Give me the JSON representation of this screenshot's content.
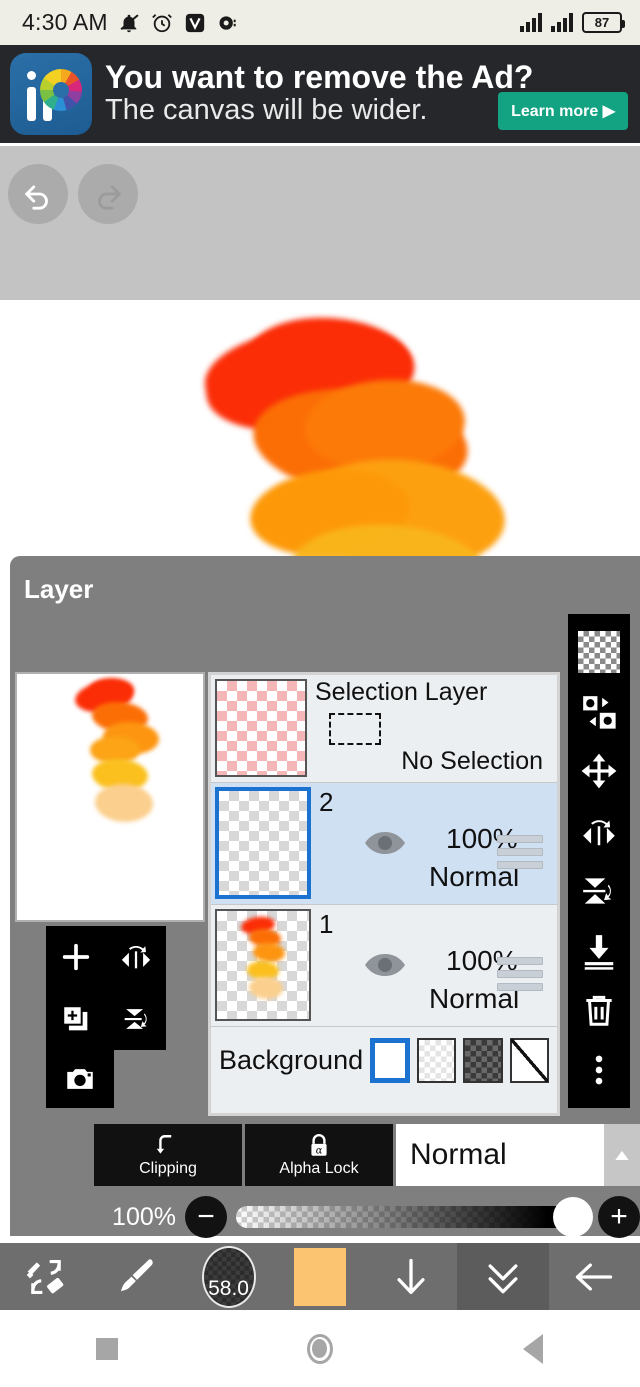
{
  "status_bar": {
    "time": "4:30 AM",
    "battery": "87",
    "icons": [
      "mute-icon",
      "alarm-icon",
      "v-app-icon",
      "record-icon"
    ]
  },
  "ad": {
    "headline": "You want to remove the Ad?",
    "subline": "The canvas will be wider.",
    "button": "Learn more ▶",
    "app": "ibisPaint"
  },
  "top_toolbar": {
    "undo": "undo",
    "redo": "redo"
  },
  "layer_panel": {
    "title": "Layer",
    "selection_layer": {
      "title": "Selection Layer",
      "status": "No Selection"
    },
    "layers": [
      {
        "name": "2",
        "opacity": "100%",
        "blend": "Normal",
        "active": true
      },
      {
        "name": "1",
        "opacity": "100%",
        "blend": "Normal",
        "active": false
      }
    ],
    "background": {
      "label": "Background",
      "options": [
        "white",
        "light-checker",
        "dark-checker",
        "diagonal"
      ],
      "selected": 0
    },
    "tools_left": [
      "add-layer",
      "flip-horizontal",
      "duplicate-layer",
      "flip-vertical",
      "camera"
    ],
    "tools_right": [
      "transparency",
      "swap-layers",
      "move",
      "flip-horizontal",
      "flip-vertical",
      "merge-down",
      "delete",
      "more-options"
    ],
    "clipping": "Clipping",
    "alpha_lock": "Alpha Lock",
    "blend_mode": "Normal",
    "opacity": "100%"
  },
  "bottom_toolbar": {
    "brush_eraser": "brush-eraser-swap",
    "brush": "brush",
    "brush_size": "58.0",
    "color": "#FBC470",
    "down_arrow": "down-arrow",
    "double_chevron": "double-chevron-down",
    "back": "back-arrow"
  },
  "nav_bar": {
    "recents": "recents",
    "home": "home",
    "back": "back"
  },
  "colors": {
    "panel_bg": "#7f7f7f",
    "accent_blue": "#1b72d0",
    "ad_green": "#13a383",
    "brush_color": "#FBC470"
  }
}
